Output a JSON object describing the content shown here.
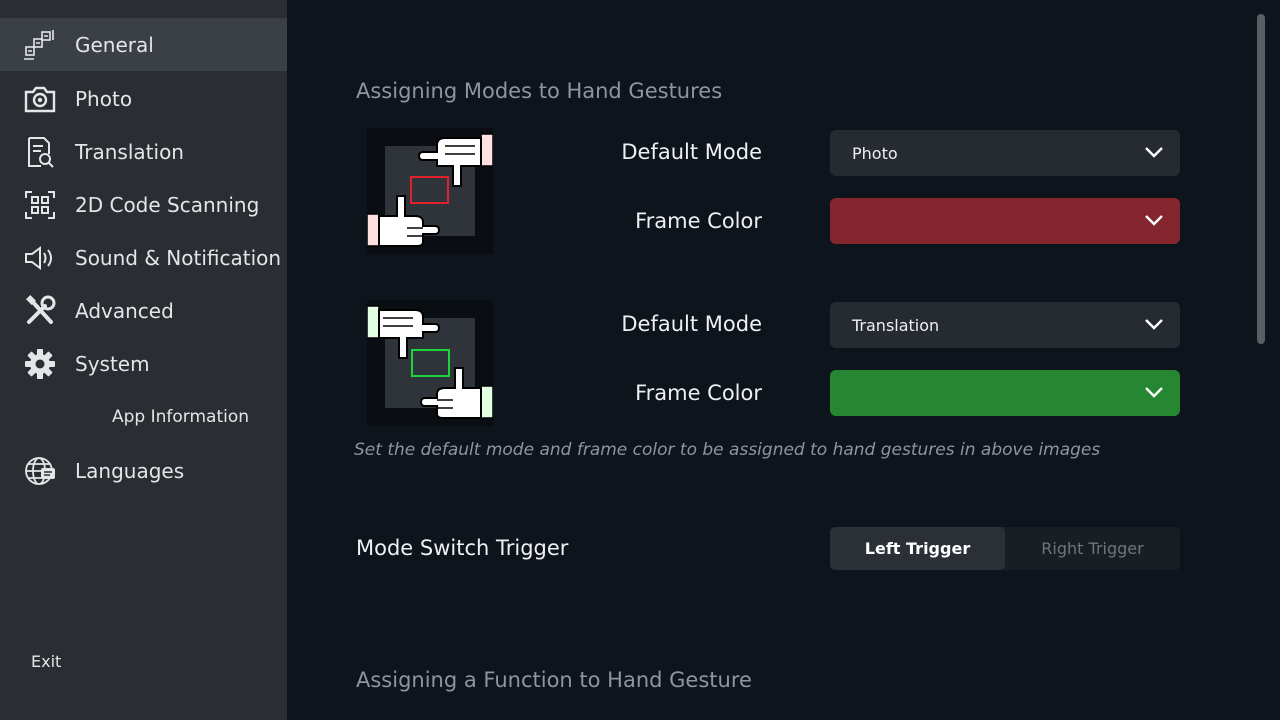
{
  "sidebar": {
    "items": [
      {
        "label": "General",
        "icon": "general-settings-icon"
      },
      {
        "label": "Photo",
        "icon": "camera-icon"
      },
      {
        "label": "Translation",
        "icon": "document-search-icon"
      },
      {
        "label": "2D Code Scanning",
        "icon": "qr-code-icon"
      },
      {
        "label": "Sound & Notification",
        "icon": "speaker-icon"
      },
      {
        "label": "Advanced",
        "icon": "tools-icon"
      },
      {
        "label": "System",
        "icon": "gear-icon"
      },
      {
        "label": "App Information"
      },
      {
        "label": "Languages",
        "icon": "globe-icon"
      }
    ],
    "exit_label": "Exit"
  },
  "main": {
    "section1_title": "Assigning Modes to Hand Gestures",
    "gesture1": {
      "default_mode_label": "Default Mode",
      "default_mode_value": "Photo",
      "frame_color_label": "Frame Color",
      "frame_color_value": "#85262f"
    },
    "gesture2": {
      "default_mode_label": "Default Mode",
      "default_mode_value": "Translation",
      "frame_color_label": "Frame Color",
      "frame_color_value": "#268733"
    },
    "hint": "Set the default mode and frame color to be assigned to hand gestures in above images",
    "mode_switch": {
      "label": "Mode Switch Trigger",
      "options": [
        "Left Trigger",
        "Right Trigger"
      ],
      "selected": "Left Trigger"
    },
    "section2_title": "Assigning a Function to Hand Gesture"
  }
}
